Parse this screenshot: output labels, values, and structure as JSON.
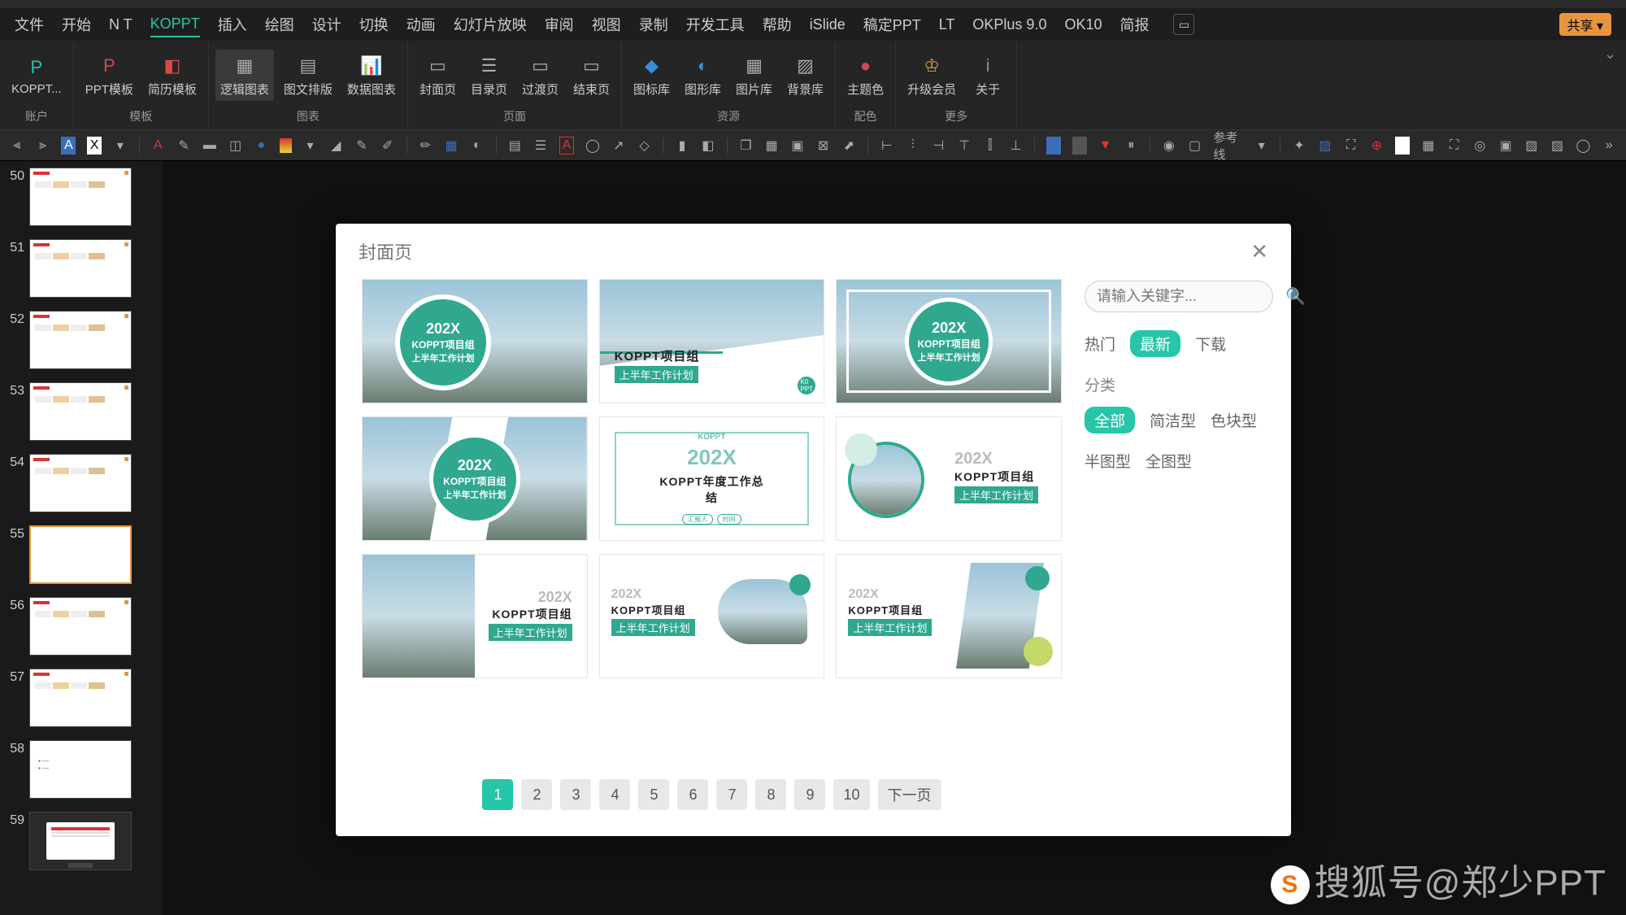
{
  "menu": {
    "items": [
      "文件",
      "开始",
      "N T",
      "KOPPT",
      "插入",
      "绘图",
      "设计",
      "切换",
      "动画",
      "幻灯片放映",
      "审阅",
      "视图",
      "录制",
      "开发工具",
      "帮助",
      "iSlide",
      "稿定PPT",
      "LT",
      "OKPlus 9.0",
      "OK10",
      "简报"
    ],
    "active_index": 3,
    "share": "共享"
  },
  "ribbon": {
    "groups": [
      {
        "label": "账户",
        "items": [
          {
            "icon": "P",
            "label": "KOPPT...",
            "color": "#26c6a8"
          }
        ]
      },
      {
        "label": "模板",
        "items": [
          {
            "icon": "P",
            "label": "PPT模板",
            "color": "#d14b4b"
          },
          {
            "icon": "◧",
            "label": "简历模板",
            "color": "#d14b4b"
          }
        ]
      },
      {
        "label": "图表",
        "items": [
          {
            "icon": "▦",
            "label": "逻辑图表",
            "hl": true
          },
          {
            "icon": "▤",
            "label": "图文排版"
          },
          {
            "icon": "📊",
            "label": "数据图表",
            "color": "#d14b4b"
          }
        ]
      },
      {
        "label": "页面",
        "items": [
          {
            "icon": "▭",
            "label": "封面页"
          },
          {
            "icon": "☰",
            "label": "目录页"
          },
          {
            "icon": "▭",
            "label": "过渡页"
          },
          {
            "icon": "▭",
            "label": "结束页"
          }
        ]
      },
      {
        "label": "资源",
        "items": [
          {
            "icon": "◆",
            "label": "图标库",
            "color": "#3a8dd8"
          },
          {
            "icon": "◐",
            "label": "图形库",
            "color": "#3a8dd8"
          },
          {
            "icon": "▦",
            "label": "图片库"
          },
          {
            "icon": "▨",
            "label": "背景库"
          }
        ]
      },
      {
        "label": "配色",
        "items": [
          {
            "icon": "●",
            "label": "主题色",
            "color": "#d14b4b"
          }
        ]
      },
      {
        "label": "更多",
        "items": [
          {
            "icon": "♔",
            "label": "升级会员",
            "color": "#d1a04b"
          },
          {
            "icon": "i",
            "label": "关于",
            "color": "#888"
          }
        ]
      }
    ],
    "guideline_label": "参考线"
  },
  "thumbnails": [
    {
      "n": 50,
      "type": "content"
    },
    {
      "n": 51,
      "type": "content"
    },
    {
      "n": 52,
      "type": "content"
    },
    {
      "n": 53,
      "type": "content"
    },
    {
      "n": 54,
      "type": "content"
    },
    {
      "n": 55,
      "type": "blank",
      "selected": true
    },
    {
      "n": 56,
      "type": "content"
    },
    {
      "n": 57,
      "type": "content"
    },
    {
      "n": 58,
      "type": "blank2"
    },
    {
      "n": 59,
      "type": "dark"
    }
  ],
  "modal": {
    "title": "封面页",
    "search_placeholder": "请输入关键字...",
    "sort": {
      "items": [
        "热门",
        "最新",
        "下载"
      ],
      "active": 1
    },
    "category_label": "分类",
    "cats1": {
      "items": [
        "全部",
        "简洁型",
        "色块型"
      ],
      "active": 0
    },
    "cats2": {
      "items": [
        "半图型",
        "全图型"
      ]
    },
    "pages": [
      "1",
      "2",
      "3",
      "4",
      "5",
      "6",
      "7",
      "8",
      "9",
      "10",
      "下一页"
    ],
    "active_page": 0,
    "tpl": {
      "year": "202X",
      "brand": "KOPPT项目组",
      "sub": "上半年工作计划",
      "annual": "KOPPT年度工作总结",
      "logo": "KOPPT"
    }
  },
  "watermark": "搜狐号@郑少PPT"
}
